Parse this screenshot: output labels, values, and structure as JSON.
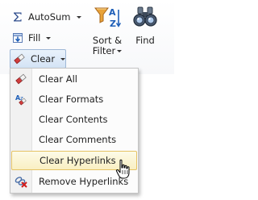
{
  "ribbon": {
    "autosum_label": "AutoSum",
    "fill_label": "Fill",
    "clear_label": "Clear",
    "sort_label_line1": "Sort &",
    "sort_label_line2": "Filter",
    "find_label": "Find",
    "icons": {
      "autosum": "sigma-icon",
      "fill": "fill-down-icon",
      "clear": "eraser-icon",
      "sort": "sort-az-funnel-icon",
      "find": "binoculars-icon"
    }
  },
  "menu": {
    "items": [
      {
        "label": "Clear All",
        "icon": "eraser-icon"
      },
      {
        "label": "Clear Formats",
        "icon": "clear-formats-icon"
      },
      {
        "label": "Clear Contents",
        "icon": ""
      },
      {
        "label": "Clear Comments",
        "icon": ""
      },
      {
        "label": "Clear Hyperlinks",
        "icon": "",
        "highlighted": true
      },
      {
        "label": "Remove Hyperlinks",
        "icon": "remove-hyperlinks-icon"
      }
    ]
  },
  "colors": {
    "highlight_fill": "#f9efc2",
    "highlight_border": "#e5c365",
    "pressed_button": "#d3e3f5",
    "eraser_red": "#d23d3d",
    "sort_blue": "#1f5fb8",
    "sort_funnel": "#e8a33a",
    "remove_x_red": "#d11b1b"
  }
}
